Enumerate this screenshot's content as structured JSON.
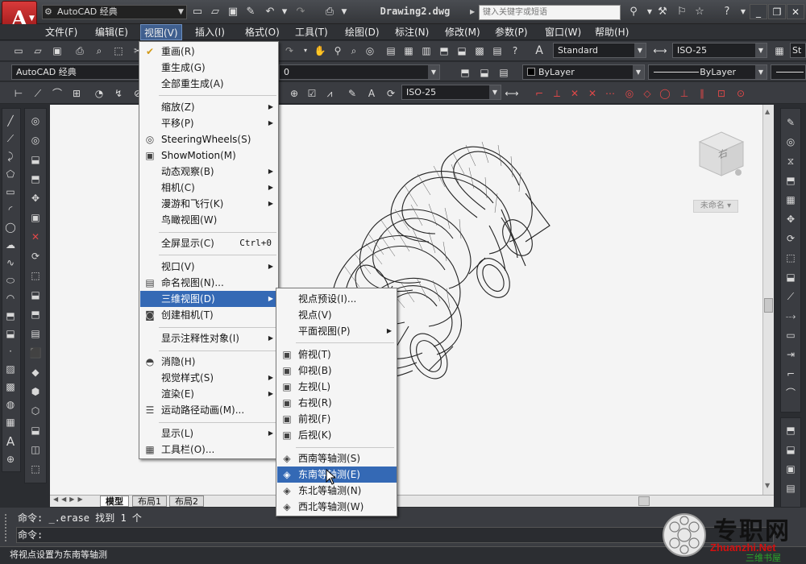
{
  "title_bar": {
    "app_logo": "A",
    "workspace": "AutoCAD 经典",
    "doc_title": "Drawing2.dwg",
    "search_placeholder": "键入关键字或短语"
  },
  "menubar": [
    "文件(F)",
    "编辑(E)",
    "视图(V)",
    "插入(I)",
    "格式(O)",
    "工具(T)",
    "绘图(D)",
    "标注(N)",
    "修改(M)",
    "参数(P)",
    "窗口(W)",
    "帮助(H)"
  ],
  "toolbar": {
    "workspace_combo": "AutoCAD 经典",
    "layer_combo": "0",
    "text_style": "Standard",
    "dim_style": "ISO-25",
    "dim_style2": "ISO-25",
    "color_combo": "ByLayer",
    "linetype_combo": "ByLayer",
    "style_combo3": "St"
  },
  "view_menu": {
    "items": [
      {
        "label": "重画",
        "acc": "(R)"
      },
      {
        "label": "重生成",
        "acc": "(G)"
      },
      {
        "label": "全部重生成",
        "acc": "(A)"
      },
      {
        "label": "缩放",
        "acc": "(Z)"
      },
      {
        "label": "平移",
        "acc": "(P)"
      },
      {
        "label": "SteeringWheels",
        "acc": "(S)"
      },
      {
        "label": "ShowMotion",
        "acc": "(M)"
      },
      {
        "label": "动态观察",
        "acc": "(B)"
      },
      {
        "label": "相机",
        "acc": "(C)"
      },
      {
        "label": "漫游和飞行",
        "acc": "(K)"
      },
      {
        "label": "鸟瞰视图",
        "acc": "(W)"
      },
      {
        "label": "全屏显示",
        "acc": "(C)",
        "shortcut": "Ctrl+0"
      },
      {
        "label": "视口",
        "acc": "(V)"
      },
      {
        "label": "命名视图",
        "acc": "(N)..."
      },
      {
        "label": "三维视图",
        "acc": "(D)"
      },
      {
        "label": "创建相机",
        "acc": "(T)"
      },
      {
        "label": "显示注释性对象",
        "acc": "(I)"
      },
      {
        "label": "消隐",
        "acc": "(H)"
      },
      {
        "label": "视觉样式",
        "acc": "(S)"
      },
      {
        "label": "渲染",
        "acc": "(E)"
      },
      {
        "label": "运动路径动画",
        "acc": "(M)..."
      },
      {
        "label": "显示",
        "acc": "(L)"
      },
      {
        "label": "工具栏",
        "acc": "(O)..."
      }
    ]
  },
  "view3d_menu": {
    "items": [
      {
        "label": "视点预设",
        "acc": "(I)..."
      },
      {
        "label": "视点",
        "acc": "(V)"
      },
      {
        "label": "平面视图",
        "acc": "(P)"
      },
      {
        "label": "俯视",
        "acc": "(T)"
      },
      {
        "label": "仰视",
        "acc": "(B)"
      },
      {
        "label": "左视",
        "acc": "(L)"
      },
      {
        "label": "右视",
        "acc": "(R)"
      },
      {
        "label": "前视",
        "acc": "(F)"
      },
      {
        "label": "后视",
        "acc": "(K)"
      },
      {
        "label": "西南等轴测",
        "acc": "(S)"
      },
      {
        "label": "东南等轴测",
        "acc": "(E)"
      },
      {
        "label": "东北等轴测",
        "acc": "(N)"
      },
      {
        "label": "西北等轴测",
        "acc": "(W)"
      }
    ]
  },
  "viewcube": {
    "face_label": "右",
    "wcs_label": "未命名"
  },
  "layout_tabs": [
    "模型",
    "布局1",
    "布局2"
  ],
  "command": {
    "line1": "命令: _.erase 找到 1 个",
    "line2": "命令:"
  },
  "status_text": "将视点设置为东南等轴测",
  "watermark": {
    "name": "专职网",
    "url": "Zhuanzhi.Net",
    "tag": "三维书屋"
  },
  "colors": {
    "accent": "#3469b5",
    "canvas": "#f4f4f4",
    "logo_red": "#c62828"
  }
}
